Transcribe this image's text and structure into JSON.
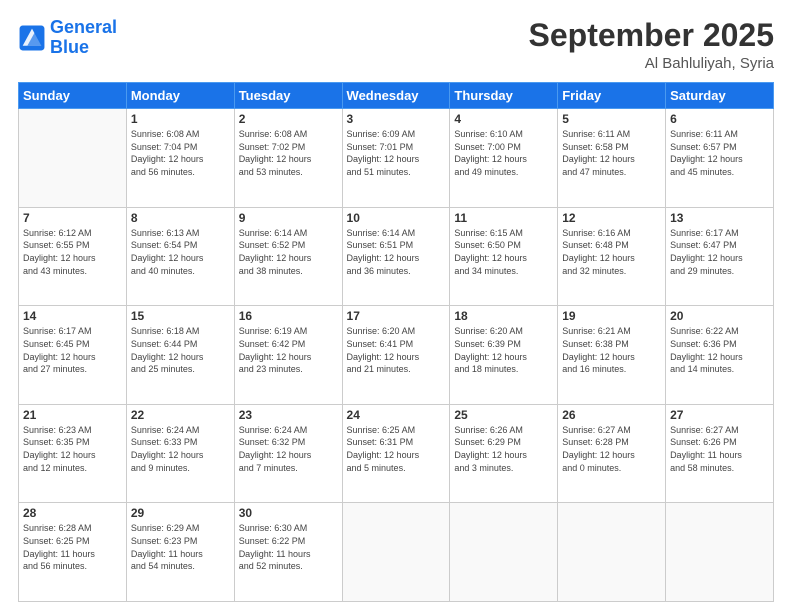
{
  "header": {
    "logo_line1": "General",
    "logo_line2": "Blue",
    "month_title": "September 2025",
    "subtitle": "Al Bahluliyah, Syria"
  },
  "days_of_week": [
    "Sunday",
    "Monday",
    "Tuesday",
    "Wednesday",
    "Thursday",
    "Friday",
    "Saturday"
  ],
  "weeks": [
    [
      {
        "day": "",
        "info": ""
      },
      {
        "day": "1",
        "info": "Sunrise: 6:08 AM\nSunset: 7:04 PM\nDaylight: 12 hours\nand 56 minutes."
      },
      {
        "day": "2",
        "info": "Sunrise: 6:08 AM\nSunset: 7:02 PM\nDaylight: 12 hours\nand 53 minutes."
      },
      {
        "day": "3",
        "info": "Sunrise: 6:09 AM\nSunset: 7:01 PM\nDaylight: 12 hours\nand 51 minutes."
      },
      {
        "day": "4",
        "info": "Sunrise: 6:10 AM\nSunset: 7:00 PM\nDaylight: 12 hours\nand 49 minutes."
      },
      {
        "day": "5",
        "info": "Sunrise: 6:11 AM\nSunset: 6:58 PM\nDaylight: 12 hours\nand 47 minutes."
      },
      {
        "day": "6",
        "info": "Sunrise: 6:11 AM\nSunset: 6:57 PM\nDaylight: 12 hours\nand 45 minutes."
      }
    ],
    [
      {
        "day": "7",
        "info": "Sunrise: 6:12 AM\nSunset: 6:55 PM\nDaylight: 12 hours\nand 43 minutes."
      },
      {
        "day": "8",
        "info": "Sunrise: 6:13 AM\nSunset: 6:54 PM\nDaylight: 12 hours\nand 40 minutes."
      },
      {
        "day": "9",
        "info": "Sunrise: 6:14 AM\nSunset: 6:52 PM\nDaylight: 12 hours\nand 38 minutes."
      },
      {
        "day": "10",
        "info": "Sunrise: 6:14 AM\nSunset: 6:51 PM\nDaylight: 12 hours\nand 36 minutes."
      },
      {
        "day": "11",
        "info": "Sunrise: 6:15 AM\nSunset: 6:50 PM\nDaylight: 12 hours\nand 34 minutes."
      },
      {
        "day": "12",
        "info": "Sunrise: 6:16 AM\nSunset: 6:48 PM\nDaylight: 12 hours\nand 32 minutes."
      },
      {
        "day": "13",
        "info": "Sunrise: 6:17 AM\nSunset: 6:47 PM\nDaylight: 12 hours\nand 29 minutes."
      }
    ],
    [
      {
        "day": "14",
        "info": "Sunrise: 6:17 AM\nSunset: 6:45 PM\nDaylight: 12 hours\nand 27 minutes."
      },
      {
        "day": "15",
        "info": "Sunrise: 6:18 AM\nSunset: 6:44 PM\nDaylight: 12 hours\nand 25 minutes."
      },
      {
        "day": "16",
        "info": "Sunrise: 6:19 AM\nSunset: 6:42 PM\nDaylight: 12 hours\nand 23 minutes."
      },
      {
        "day": "17",
        "info": "Sunrise: 6:20 AM\nSunset: 6:41 PM\nDaylight: 12 hours\nand 21 minutes."
      },
      {
        "day": "18",
        "info": "Sunrise: 6:20 AM\nSunset: 6:39 PM\nDaylight: 12 hours\nand 18 minutes."
      },
      {
        "day": "19",
        "info": "Sunrise: 6:21 AM\nSunset: 6:38 PM\nDaylight: 12 hours\nand 16 minutes."
      },
      {
        "day": "20",
        "info": "Sunrise: 6:22 AM\nSunset: 6:36 PM\nDaylight: 12 hours\nand 14 minutes."
      }
    ],
    [
      {
        "day": "21",
        "info": "Sunrise: 6:23 AM\nSunset: 6:35 PM\nDaylight: 12 hours\nand 12 minutes."
      },
      {
        "day": "22",
        "info": "Sunrise: 6:24 AM\nSunset: 6:33 PM\nDaylight: 12 hours\nand 9 minutes."
      },
      {
        "day": "23",
        "info": "Sunrise: 6:24 AM\nSunset: 6:32 PM\nDaylight: 12 hours\nand 7 minutes."
      },
      {
        "day": "24",
        "info": "Sunrise: 6:25 AM\nSunset: 6:31 PM\nDaylight: 12 hours\nand 5 minutes."
      },
      {
        "day": "25",
        "info": "Sunrise: 6:26 AM\nSunset: 6:29 PM\nDaylight: 12 hours\nand 3 minutes."
      },
      {
        "day": "26",
        "info": "Sunrise: 6:27 AM\nSunset: 6:28 PM\nDaylight: 12 hours\nand 0 minutes."
      },
      {
        "day": "27",
        "info": "Sunrise: 6:27 AM\nSunset: 6:26 PM\nDaylight: 11 hours\nand 58 minutes."
      }
    ],
    [
      {
        "day": "28",
        "info": "Sunrise: 6:28 AM\nSunset: 6:25 PM\nDaylight: 11 hours\nand 56 minutes."
      },
      {
        "day": "29",
        "info": "Sunrise: 6:29 AM\nSunset: 6:23 PM\nDaylight: 11 hours\nand 54 minutes."
      },
      {
        "day": "30",
        "info": "Sunrise: 6:30 AM\nSunset: 6:22 PM\nDaylight: 11 hours\nand 52 minutes."
      },
      {
        "day": "",
        "info": ""
      },
      {
        "day": "",
        "info": ""
      },
      {
        "day": "",
        "info": ""
      },
      {
        "day": "",
        "info": ""
      }
    ]
  ]
}
